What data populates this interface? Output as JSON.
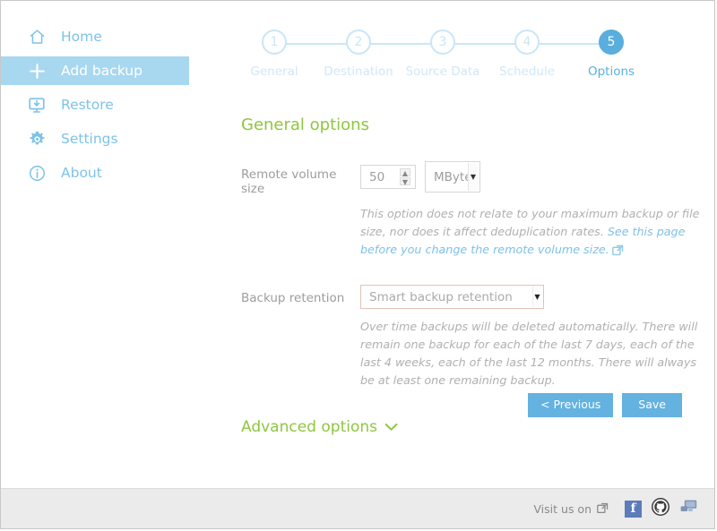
{
  "sidebar": {
    "items": [
      {
        "label": "Home",
        "icon": "home-icon",
        "active": false
      },
      {
        "label": "Add backup",
        "icon": "plus-icon",
        "active": true
      },
      {
        "label": "Restore",
        "icon": "restore-monitor-icon",
        "active": false
      },
      {
        "label": "Settings",
        "icon": "gear-icon",
        "active": false
      },
      {
        "label": "About",
        "icon": "info-icon",
        "active": false
      }
    ]
  },
  "stepper": {
    "steps": [
      {
        "number": "1",
        "label": "General",
        "active": false
      },
      {
        "number": "2",
        "label": "Destination",
        "active": false
      },
      {
        "number": "3",
        "label": "Source Data",
        "active": false
      },
      {
        "number": "4",
        "label": "Schedule",
        "active": false
      },
      {
        "number": "5",
        "label": "Options",
        "active": true
      }
    ]
  },
  "main": {
    "section_title": "General options",
    "remote_volume": {
      "label": "Remote volume size",
      "value": "50",
      "unit": "MByte",
      "help_prefix": "This option does not relate to your maximum backup or file size, nor does it affect deduplication rates. ",
      "help_link": "See this page before you change the remote volume size.",
      "link_icon": "external-link-icon"
    },
    "backup_retention": {
      "label": "Backup retention",
      "value": "Smart backup retention",
      "help": "Over time backups will be deleted automatically. There will remain one backup for each of the last 7 days, each of the last 4 weeks, each of the last 12 months. There will always be at least one remaining backup."
    },
    "advanced_options": {
      "label": "Advanced options",
      "icon": "chevron-down-icon"
    },
    "buttons": {
      "previous": "< Previous",
      "save": "Save"
    }
  },
  "footer": {
    "visit_text": "Visit us on",
    "visit_icon": "external-link-icon",
    "social": [
      {
        "name": "facebook-icon",
        "glyph": "f"
      },
      {
        "name": "github-icon",
        "glyph": ""
      },
      {
        "name": "forum-icon",
        "glyph": ""
      }
    ]
  },
  "colors": {
    "accent_blue": "#59aedd",
    "light_blue": "#a8d7f0",
    "pale_blue": "#c9e6f7",
    "green": "#8ec63f",
    "retention_border": "#e2c3b5",
    "footer_bg": "#ebebeb"
  }
}
